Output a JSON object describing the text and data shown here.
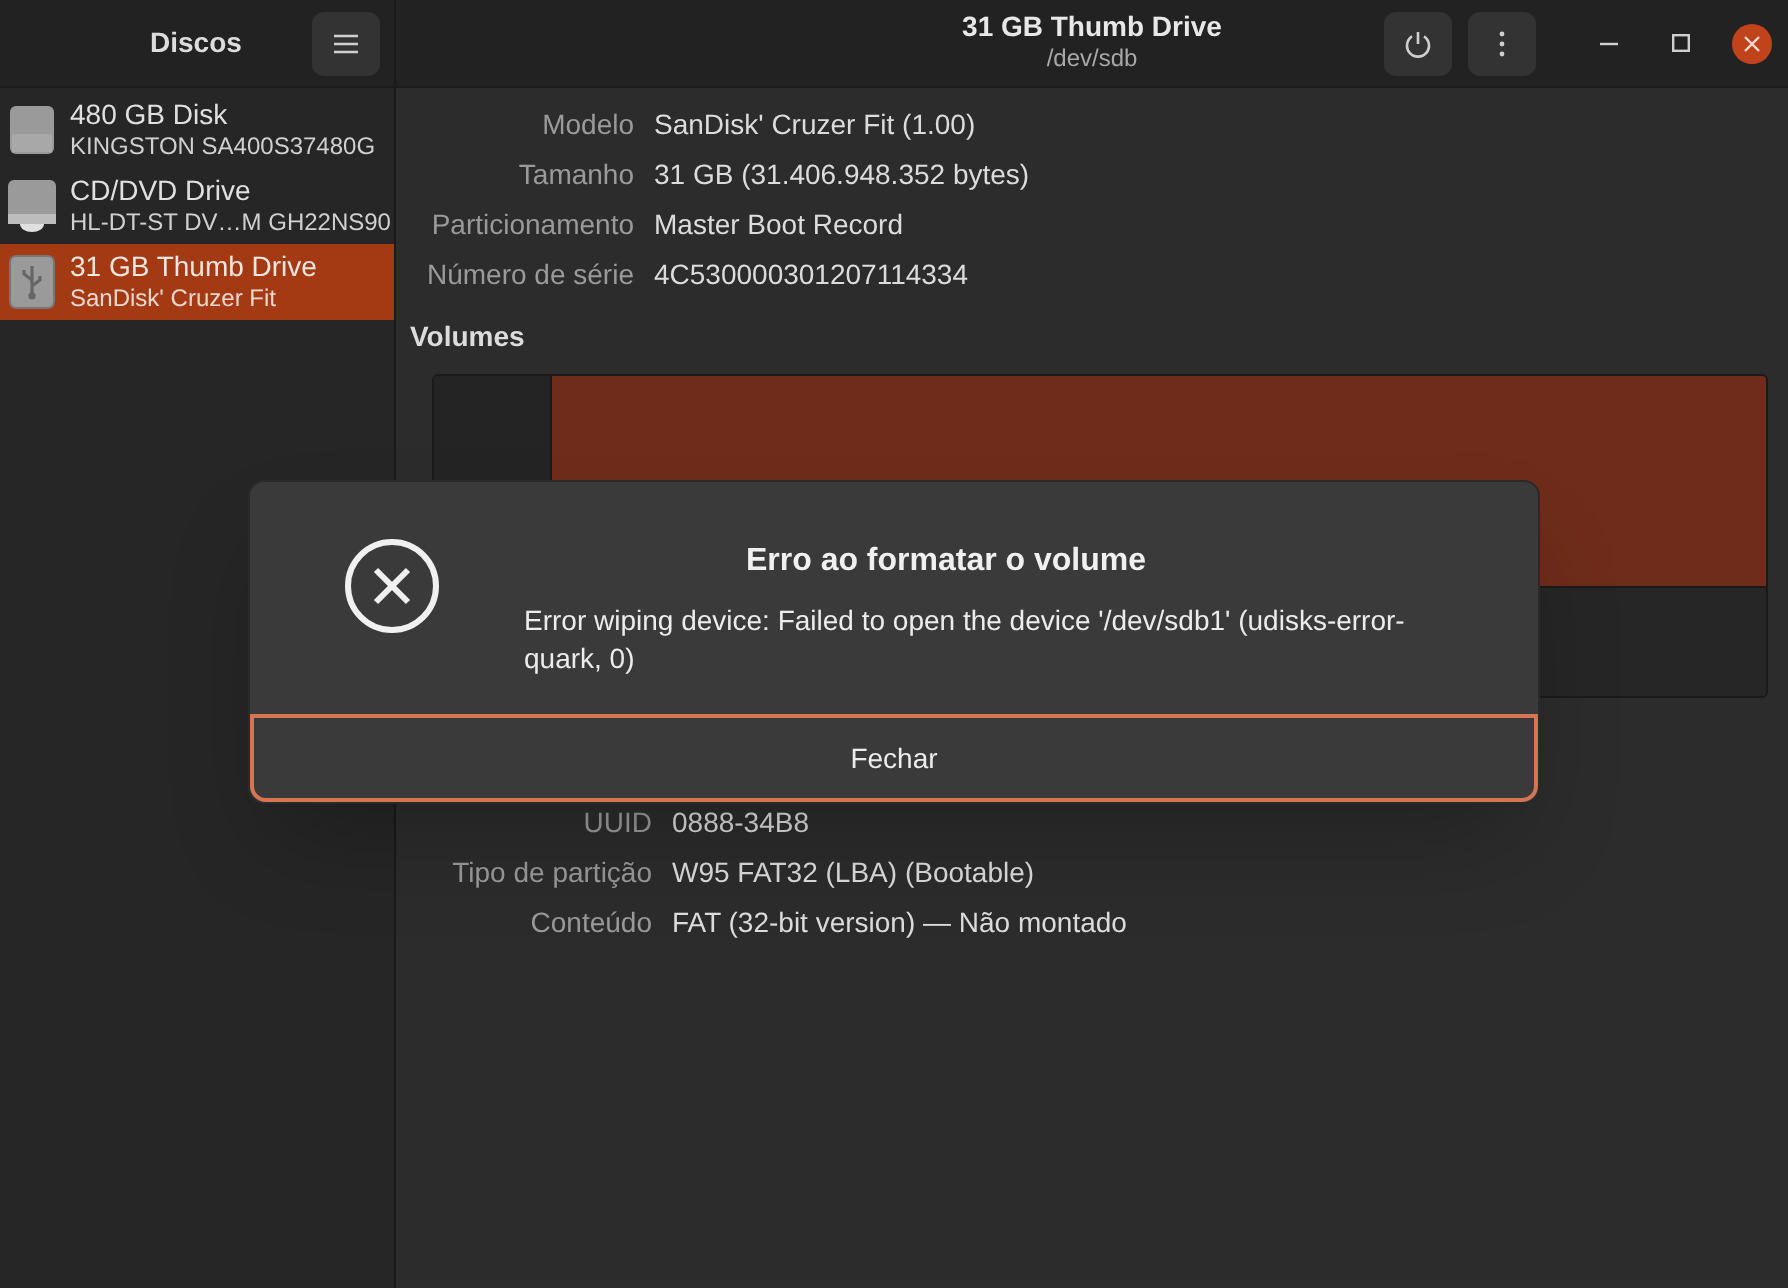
{
  "sidebar": {
    "title": "Discos",
    "disks": [
      {
        "kind": "ssd",
        "name": "480 GB Disk",
        "model": "KINGSTON SA400S37480G",
        "selected": false
      },
      {
        "kind": "optical",
        "name": "CD/DVD Drive",
        "model": "HL-DT-ST DV…M GH22NS90",
        "selected": false
      },
      {
        "kind": "usb",
        "name": "31 GB Thumb Drive",
        "model": "SanDisk' Cruzer Fit",
        "selected": true
      }
    ]
  },
  "header": {
    "title": "31 GB Thumb Drive",
    "subtitle": "/dev/sdb"
  },
  "drive_info": [
    {
      "label": "Modelo",
      "value": "SanDisk' Cruzer Fit (1.00)"
    },
    {
      "label": "Tamanho",
      "value": "31 GB (31.406.948.352 bytes)"
    },
    {
      "label": "Particionamento",
      "value": "Master Boot Record"
    },
    {
      "label": "Número de série",
      "value": "4C530000301207114334"
    }
  ],
  "volumes": {
    "heading": "Volumes"
  },
  "volume_info": [
    {
      "label": "UUID",
      "value": "0888-34B8"
    },
    {
      "label": "Tipo de partição",
      "value": "W95 FAT32 (LBA) (Bootable)"
    },
    {
      "label": "Conteúdo",
      "value": "FAT (32-bit version) — Não montado"
    }
  ],
  "dialog": {
    "title": "Erro ao formatar o volume",
    "message": "Error wiping device: Failed to open the device '/dev/sdb1' (udisks-error-quark, 0)",
    "button": "Fechar"
  }
}
